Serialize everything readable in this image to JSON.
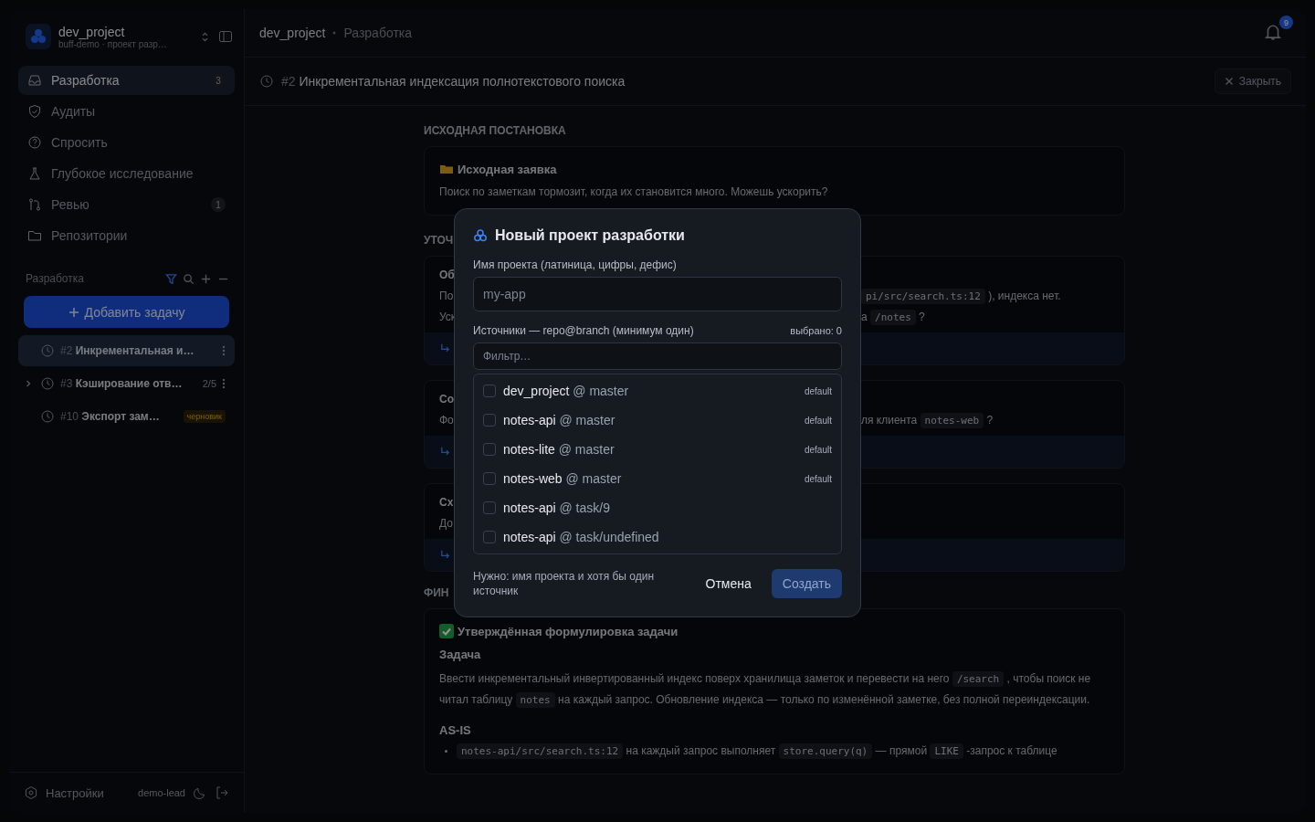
{
  "workspace": {
    "name": "dev_project",
    "subtitle": "buff-demo · проект разр…"
  },
  "nav": [
    {
      "label": "Разработка",
      "selected": true,
      "badge": "3"
    },
    {
      "label": "Аудиты",
      "selected": false
    },
    {
      "label": "Спросить",
      "selected": false
    },
    {
      "label": "Глубокое исследование",
      "selected": false
    },
    {
      "label": "Ревью",
      "selected": false,
      "badge": "1"
    },
    {
      "label": "Репозитории",
      "selected": false
    }
  ],
  "tasks_section": {
    "title": "Разработка",
    "add_button": "Добавить задачу"
  },
  "tasks": [
    {
      "number": "#2",
      "title": "Инкрементальная и…",
      "selected": true
    },
    {
      "number": "#3",
      "title": "Кэширование отв…",
      "selected": false,
      "expanded": false,
      "progress": "2/5"
    },
    {
      "number": "#10",
      "title": "Экспорт зам…",
      "selected": false,
      "tag": "черновик"
    }
  ],
  "footer": {
    "settings": "Настройки",
    "user": "demo-lead"
  },
  "breadcrumb": [
    "dev_project",
    "Разработка"
  ],
  "notifications": {
    "count": "9"
  },
  "task_header": {
    "number": "#2",
    "title": "Инкрементальная индексация полнотекстового поиска",
    "close": "Закрыть"
  },
  "sections": [
    {
      "title": "ИСХОДНАЯ ПОСТАНОВКА",
      "cards": [
        {
          "kind": "request",
          "title": "Исходная заявка",
          "text": "Поиск по заметкам тормозит, когда их становится много. Можешь ускорить?"
        }
      ]
    },
    {
      "title": "УТОЧ",
      "cards": [
        {
          "kind": "question",
          "lines": [
            {
              "left": "Об"
            },
            {
              "left": "По",
              "right": [
                {
                  "code": true,
                  "text": "pi/src/search.ts:12"
                },
                {
                  "code": false,
                  "text": "), индекса нет."
                }
              ]
            },
            {
              "left": "Уск",
              "right": [
                {
                  "code": false,
                  "text": "а"
                },
                {
                  "code": true,
                  "text": "/notes"
                },
                {
                  "code": false,
                  "text": "?"
                }
              ]
            }
          ]
        },
        {
          "kind": "question",
          "lines": [
            {
              "left": "Со"
            },
            {
              "left": "Фо",
              "right": [
                {
                  "code": false,
                  "text": "ля клиента"
                },
                {
                  "code": true,
                  "text": "notes-web"
                },
                {
                  "code": false,
                  "text": "?"
                }
              ]
            }
          ]
        },
        {
          "kind": "question",
          "lines": [
            {
              "left": "Сх"
            },
            {
              "left": "До"
            }
          ]
        }
      ]
    },
    {
      "title": "ФИН",
      "cards": [
        {
          "kind": "final",
          "title": "Утверждённая формулировка задачи",
          "heading": "Задача",
          "paragraph": [
            {
              "code": false,
              "text": "Ввести инкрементальный инвертированный индекс поверх хранилища заметок и перевести на него"
            },
            {
              "code": true,
              "text": "/search"
            },
            {
              "code": false,
              "text": ", чтобы поиск не читал таблицу"
            },
            {
              "code": true,
              "text": "notes"
            },
            {
              "code": false,
              "text": "на каждый запрос. Обновление индекса — только по изменённой заметке, без полной переиндексации."
            }
          ],
          "heading2": "AS-IS",
          "bullet": [
            {
              "code": true,
              "text": "notes-api/src/search.ts:12"
            },
            {
              "code": false,
              "text": "на каждый запрос выполняет"
            },
            {
              "code": true,
              "text": "store.query(q)"
            },
            {
              "code": false,
              "text": "— прямой"
            },
            {
              "code": true,
              "text": "LIKE"
            },
            {
              "code": false,
              "text": "-запрос к таблице"
            }
          ]
        }
      ]
    }
  ],
  "modal": {
    "title": "Новый проект разработки",
    "name_label": "Имя проекта (латиница, цифры, дефис)",
    "name_placeholder": "my-app",
    "sources_label": "Источники — repo@branch (минимум один)",
    "selected_count": "выбрано: 0",
    "filter_placeholder": "Фильтр…",
    "sources": [
      {
        "repo": "dev_project",
        "branch": "@ master",
        "checked": false,
        "tag": "default"
      },
      {
        "repo": "notes-api",
        "branch": "@ master",
        "checked": false,
        "tag": "default"
      },
      {
        "repo": "notes-lite",
        "branch": "@ master",
        "checked": false,
        "tag": "default"
      },
      {
        "repo": "notes-web",
        "branch": "@ master",
        "checked": false,
        "tag": "default"
      },
      {
        "repo": "notes-api",
        "branch": "@ task/9",
        "checked": false
      },
      {
        "repo": "notes-api",
        "branch": "@ task/undefined",
        "checked": false
      }
    ],
    "hint": "Нужно: имя проекта и хотя бы один источник",
    "cancel": "Отмена",
    "create": "Создать",
    "create_disabled": true
  }
}
